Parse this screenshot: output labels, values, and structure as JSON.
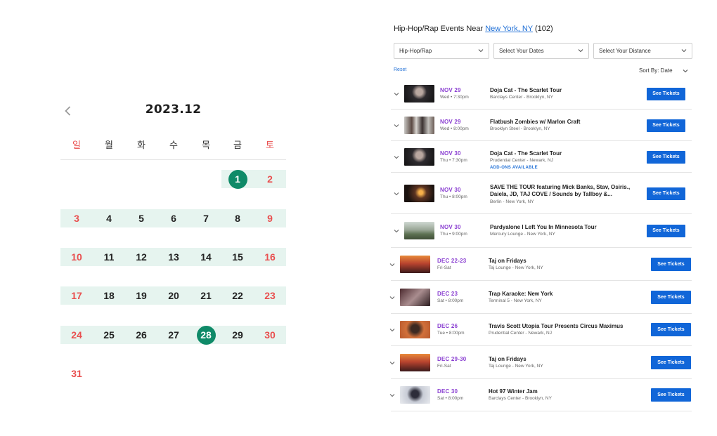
{
  "calendar": {
    "title": "2023.12",
    "weekdays": [
      "일",
      "월",
      "화",
      "수",
      "목",
      "금",
      "토"
    ],
    "weeks": [
      [
        "",
        "",
        "",
        "",
        "",
        "1",
        "2"
      ],
      [
        "3",
        "4",
        "5",
        "6",
        "7",
        "8",
        "9"
      ],
      [
        "10",
        "11",
        "12",
        "13",
        "14",
        "15",
        "16"
      ],
      [
        "17",
        "18",
        "19",
        "20",
        "21",
        "22",
        "23"
      ],
      [
        "24",
        "25",
        "26",
        "27",
        "28",
        "29",
        "30"
      ],
      [
        "31",
        "",
        "",
        "",
        "",
        "",
        ""
      ]
    ],
    "selected_days": [
      "1",
      "28"
    ],
    "colors": {
      "highlight": "#e6f4ef",
      "selected": "#0f8a68",
      "weekend": "#e94f4f"
    }
  },
  "events": {
    "heading_prefix": "Hip-Hop/Rap Events Near",
    "location_link": "New York, NY",
    "count": "(102)",
    "filters": {
      "genre": "Hip-Hop/Rap",
      "dates": "Select Your Dates",
      "distance": "Select Your Distance"
    },
    "reset_label": "Reset",
    "sort_label": "Sort By: Date",
    "button_label": "See Tickets",
    "list": [
      {
        "date": "NOV 29",
        "when": "Wed • 7:30pm",
        "name": "Doja Cat - The Scarlet Tour",
        "venue": "Barclays Center - Brooklyn, NY",
        "extra": ""
      },
      {
        "date": "NOV 29",
        "when": "Wed • 8:00pm",
        "name": "Flatbush Zombies w/ Marlon Craft",
        "venue": "Brooklyn Steel - Brooklyn, NY",
        "extra": ""
      },
      {
        "date": "NOV 30",
        "when": "Thu • 7:30pm",
        "name": "Doja Cat - The Scarlet Tour",
        "venue": "Prudential Center - Newark, NJ",
        "extra": "ADD-ONS AVAILABLE"
      },
      {
        "date": "NOV 30",
        "when": "Thu • 8:00pm",
        "name": "SAVE THE TOUR featuring Mick Banks, Stav, Osiris., Daiela, JD, TAJ COVE / Sounds by Tallboy &...",
        "venue": "Berlin - New York, NY",
        "extra": ""
      },
      {
        "date": "NOV 30",
        "when": "Thu • 9:00pm",
        "name": "Pardyalone I Left You In Minnesota Tour",
        "venue": "Mercury Lounge - New York, NY",
        "extra": ""
      },
      {
        "date": "DEC 22-23",
        "when": "Fri-Sat",
        "name": "Taj on Fridays",
        "venue": "Taj Lounge - New York, NY",
        "extra": ""
      },
      {
        "date": "DEC 23",
        "when": "Sat • 8:00pm",
        "name": "Trap Karaoke: New York",
        "venue": "Terminal 5 - New York, NY",
        "extra": ""
      },
      {
        "date": "DEC 26",
        "when": "Tue • 8:00pm",
        "name": "Travis Scott Utopia Tour Presents Circus Maximus",
        "venue": "Prudential Center - Newark, NJ",
        "extra": ""
      },
      {
        "date": "DEC 29-30",
        "when": "Fri-Sat",
        "name": "Taj on Fridays",
        "venue": "Taj Lounge - New York, NY",
        "extra": ""
      },
      {
        "date": "DEC 30",
        "when": "Sat • 8:00pm",
        "name": "Hot 97 Winter Jam",
        "venue": "Barclays Center - Brooklyn, NY",
        "extra": ""
      }
    ],
    "colors": {
      "date": "#8a3fd1",
      "button": "#1166d8",
      "link": "#1f6fd6"
    }
  }
}
